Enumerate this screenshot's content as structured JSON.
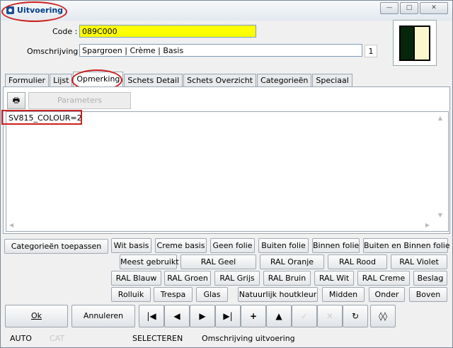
{
  "window": {
    "title": "Uitvoering"
  },
  "form": {
    "code_label": "Code :",
    "code_value": "089C000",
    "omschrijving_label": "Omschrijving :",
    "omschrijving_value": "Spargroen | Crème | Basis",
    "counter": "1"
  },
  "preview": {
    "colors": [
      "#06260b",
      "#fbf7cc"
    ]
  },
  "tabs": [
    "Formulier",
    "Lijst",
    "Opmerking",
    "Schets Detail",
    "Schets Overzicht",
    "Categorieën",
    "Speciaal"
  ],
  "active_tab": "Opmerking",
  "toolbar": {
    "print_icon": "printer-icon",
    "parameters_label": "Parameters"
  },
  "memo": {
    "text": "SV815_COLOUR=2"
  },
  "category_buttons": {
    "apply_label": "Categorieën toepassen",
    "row1": [
      "Wit basis",
      "Creme basis",
      "Geen folie",
      "Buiten folie",
      "Binnen folie",
      "Buiten en Binnen folie"
    ],
    "row2": [
      "Meest gebruikt",
      "RAL Geel",
      "RAL Oranje",
      "RAL Rood",
      "RAL Violet"
    ],
    "row3": [
      "RAL Blauw",
      "RAL Groen",
      "RAL Grijs",
      "RAL Bruin",
      "RAL Wit",
      "RAL Creme",
      "Beslag"
    ],
    "row4": [
      "Rolluik",
      "Trespa",
      "Glas",
      "Natuurlijk houtkleur",
      "Midden",
      "Onder",
      "Boven"
    ]
  },
  "footer": {
    "ok_label": "Ok",
    "cancel_label": "Annuleren"
  },
  "status": {
    "mode": "AUTO",
    "cat": "CAT",
    "state": "SELECTEREN",
    "hint": "Omschrijving uitvoering"
  },
  "accent": {
    "highlight": "#ffff00",
    "annotation": "#cc1f1f",
    "title_color": "#003d8c"
  }
}
